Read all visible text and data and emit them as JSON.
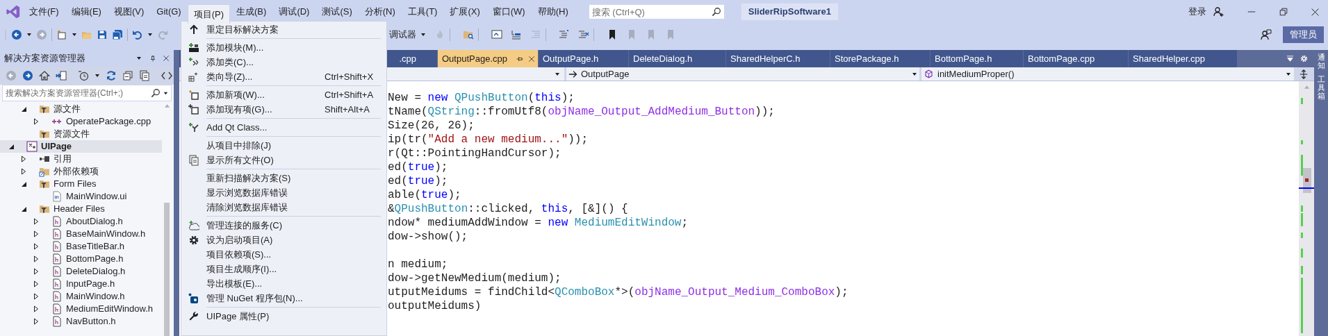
{
  "menu_bar": {
    "items": [
      {
        "label": "文件(F)",
        "selected": false
      },
      {
        "label": "编辑(E)",
        "selected": false
      },
      {
        "label": "视图(V)",
        "selected": false
      },
      {
        "label": "Git(G)",
        "selected": false
      },
      {
        "label": "项目(P)",
        "selected": true
      },
      {
        "label": "生成(B)",
        "selected": false
      },
      {
        "label": "调试(D)",
        "selected": false
      },
      {
        "label": "测试(S)",
        "selected": false
      },
      {
        "label": "分析(N)",
        "selected": false
      },
      {
        "label": "工具(T)",
        "selected": false
      },
      {
        "label": "扩展(X)",
        "selected": false
      },
      {
        "label": "窗口(W)",
        "selected": false
      },
      {
        "label": "帮助(H)",
        "selected": false
      }
    ],
    "search": {
      "placeholder": "搜索 (Ctrl+Q)"
    },
    "solution_name": "SliderRipSoftware1",
    "sign_in": "登录"
  },
  "toolbar": {
    "debugger_label": "调试器",
    "admin_button": "管理员"
  },
  "solution_explorer": {
    "title": "解决方案资源管理器",
    "search": {
      "placeholder": "搜索解决方案资源管理器(Ctrl+;)"
    },
    "tree": {
      "continued": [
        {
          "label": "源文件",
          "kind": "filter",
          "selected": false,
          "expanded": true,
          "children": [
            {
              "label": "OperatePackage.cpp",
              "kind": "cpp",
              "selected": false,
              "expanded": false
            }
          ]
        },
        {
          "label": "资源文件",
          "kind": "filter",
          "selected": false
        }
      ],
      "items": [
        {
          "label": "UIPage",
          "kind": "project",
          "selected": true,
          "expanded": true,
          "children": [
            {
              "label": "引用",
              "kind": "references",
              "selected": false,
              "expanded": false
            },
            {
              "label": "外部依赖项",
              "kind": "external",
              "selected": false,
              "expanded": false
            },
            {
              "label": "Form Files",
              "kind": "filter",
              "selected": false,
              "expanded": true,
              "children": [
                {
                  "label": "MainWindow.ui",
                  "kind": "ui",
                  "selected": false
                }
              ]
            },
            {
              "label": "Header Files",
              "kind": "filter",
              "selected": false,
              "expanded": true,
              "children": [
                {
                  "label": "AboutDialog.h",
                  "kind": "header",
                  "selected": false,
                  "expanded": false
                },
                {
                  "label": "BaseMainWindow.h",
                  "kind": "header",
                  "selected": false,
                  "expanded": false
                },
                {
                  "label": "BaseTitleBar.h",
                  "kind": "header",
                  "selected": false,
                  "expanded": false
                },
                {
                  "label": "BottomPage.h",
                  "kind": "header",
                  "selected": false,
                  "expanded": false
                },
                {
                  "label": "DeleteDialog.h",
                  "kind": "header",
                  "selected": false,
                  "expanded": false
                },
                {
                  "label": "InputPage.h",
                  "kind": "header",
                  "selected": false,
                  "expanded": false
                },
                {
                  "label": "MainWindow.h",
                  "kind": "header",
                  "selected": false,
                  "expanded": false
                },
                {
                  "label": "MediumEditWindow.h",
                  "kind": "header",
                  "selected": false,
                  "expanded": false
                },
                {
                  "label": "NavButton.h",
                  "kind": "header",
                  "selected": false,
                  "expanded": false
                }
              ]
            }
          ]
        }
      ]
    }
  },
  "editor": {
    "tabs": [
      {
        "label": ".cpp",
        "selected": false
      },
      {
        "label": "OutputPage.cpp",
        "selected": true
      },
      {
        "label": "OutputPage.h",
        "selected": false
      },
      {
        "label": "DeleteDialog.h",
        "selected": false
      },
      {
        "label": "SharedHelperC.h",
        "selected": false
      },
      {
        "label": "StorePackage.h",
        "selected": false
      },
      {
        "label": "BottomPage.h",
        "selected": false
      },
      {
        "label": "BottomPage.cpp",
        "selected": false
      },
      {
        "label": "SharedHelper.cpp",
        "selected": false
      }
    ],
    "nav": {
      "scope": "OutputPage",
      "member": "initMediumProper()"
    },
    "code_lines": [
      {
        "kind": "code",
        "tokens": [
          {
            "kind": "plain",
            "text": "New = "
          },
          {
            "kind": "keyword",
            "text": "new "
          },
          {
            "kind": "type",
            "text": "QPushButton"
          },
          {
            "kind": "plain",
            "text": "("
          },
          {
            "kind": "keyword",
            "text": "this"
          },
          {
            "kind": "plain",
            "text": ");"
          }
        ]
      },
      {
        "kind": "code",
        "tokens": [
          {
            "kind": "plain",
            "text": "tName("
          },
          {
            "kind": "type",
            "text": "QString"
          },
          {
            "kind": "plain",
            "text": "::fromUtf8("
          },
          {
            "kind": "macro",
            "text": "objName_Output_AddMedium_Button"
          },
          {
            "kind": "plain",
            "text": "));"
          }
        ]
      },
      {
        "kind": "code",
        "tokens": [
          {
            "kind": "plain",
            "text": "Size(26, 26);"
          }
        ]
      },
      {
        "kind": "code",
        "tokens": [
          {
            "kind": "plain",
            "text": "ip(tr("
          },
          {
            "kind": "string",
            "text": "\"Add a new medium...\""
          },
          {
            "kind": "plain",
            "text": "));"
          }
        ]
      },
      {
        "kind": "code",
        "tokens": [
          {
            "kind": "plain",
            "text": "r(Qt::PointingHandCursor);"
          }
        ]
      },
      {
        "kind": "code",
        "tokens": [
          {
            "kind": "plain",
            "text": "ed("
          },
          {
            "kind": "keyword",
            "text": "true"
          },
          {
            "kind": "plain",
            "text": ");"
          }
        ]
      },
      {
        "kind": "code",
        "tokens": [
          {
            "kind": "plain",
            "text": "ed("
          },
          {
            "kind": "keyword",
            "text": "true"
          },
          {
            "kind": "plain",
            "text": ");"
          }
        ]
      },
      {
        "kind": "code",
        "tokens": [
          {
            "kind": "plain",
            "text": "able("
          },
          {
            "kind": "keyword",
            "text": "true"
          },
          {
            "kind": "plain",
            "text": ");"
          }
        ]
      },
      {
        "kind": "code",
        "tokens": [
          {
            "kind": "plain",
            "text": "&"
          },
          {
            "kind": "type",
            "text": "QPushButton"
          },
          {
            "kind": "plain",
            "text": "::clicked, "
          },
          {
            "kind": "keyword",
            "text": "this"
          },
          {
            "kind": "plain",
            "text": ", [&]() {"
          }
        ]
      },
      {
        "kind": "code",
        "tokens": [
          {
            "kind": "plain",
            "text": "ndow* mediumAddWindow = "
          },
          {
            "kind": "keyword",
            "text": "new "
          },
          {
            "kind": "type",
            "text": "MediumEditWindow"
          },
          {
            "kind": "plain",
            "text": ";"
          }
        ]
      },
      {
        "kind": "code",
        "tokens": [
          {
            "kind": "plain",
            "text": "dow->show();"
          }
        ]
      },
      {
        "kind": "blank"
      },
      {
        "kind": "code",
        "tokens": [
          {
            "kind": "plain",
            "text": "n medium;"
          }
        ]
      },
      {
        "kind": "code",
        "tokens": [
          {
            "kind": "plain",
            "text": "dow->getNewMedium(medium);"
          }
        ]
      },
      {
        "kind": "code",
        "tokens": [
          {
            "kind": "plain",
            "text": "utputMeidums = findChild<"
          },
          {
            "kind": "type",
            "text": "QComboBox"
          },
          {
            "kind": "plain",
            "text": "*>("
          },
          {
            "kind": "macro",
            "text": "objName_Output_Medium_ComboBox"
          },
          {
            "kind": "plain",
            "text": ");"
          }
        ]
      },
      {
        "kind": "code",
        "tokens": [
          {
            "kind": "plain",
            "text": "outputMeidums)"
          }
        ]
      }
    ]
  },
  "side_strip": [
    "通知",
    "工具箱"
  ],
  "project_menu": {
    "groups": [
      [
        {
          "label": "重定目标解决方案"
        }
      ],
      [
        {
          "label": "添加模块(M)..."
        },
        {
          "label": "添加类(C)..."
        },
        {
          "label": "类向导(Z)...",
          "shortcut": "Ctrl+Shift+X"
        }
      ],
      [
        {
          "label": "添加新项(W)...",
          "shortcut": "Ctrl+Shift+A"
        },
        {
          "label": "添加现有项(G)...",
          "shortcut": "Shift+Alt+A"
        }
      ],
      [
        {
          "label": "Add Qt Class..."
        }
      ],
      [
        {
          "label": "从项目中排除(J)"
        },
        {
          "label": "显示所有文件(O)"
        }
      ],
      [
        {
          "label": "重新扫描解决方案(S)"
        },
        {
          "label": "显示浏览数据库错误"
        },
        {
          "label": "清除浏览数据库错误"
        }
      ],
      [
        {
          "label": "管理连接的服务(C)"
        },
        {
          "label": "设为启动项目(A)"
        },
        {
          "label": "项目依赖项(S)..."
        },
        {
          "label": "项目生成顺序(I)..."
        },
        {
          "label": "导出模板(E)..."
        },
        {
          "label": "管理 NuGet 程序包(N)..."
        }
      ],
      [
        {
          "label": "UIPage 属性(P)"
        }
      ]
    ]
  }
}
